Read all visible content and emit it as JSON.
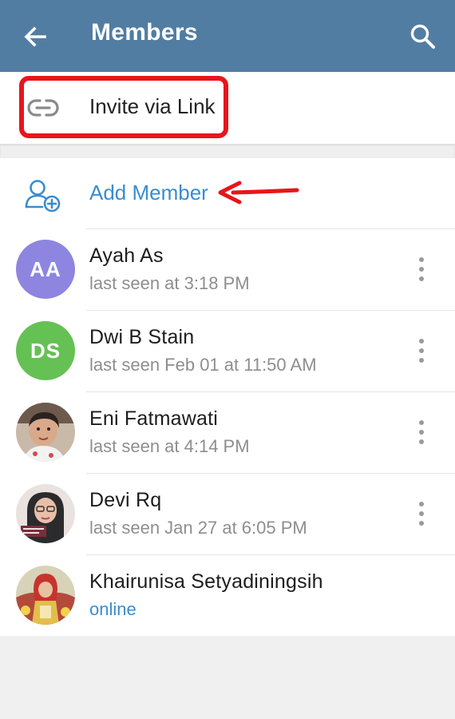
{
  "header": {
    "title": "Members",
    "back_icon": "arrow-left-icon",
    "search_icon": "search-icon",
    "background": "#527da3"
  },
  "invite": {
    "label": "Invite via Link",
    "icon": "link-icon"
  },
  "add_member": {
    "label": "Add Member",
    "icon": "add-user-icon",
    "color": "#3a8ccf"
  },
  "annotation_colors": {
    "highlight": "#e8151b"
  },
  "members": [
    {
      "name": "Ayah As",
      "status": "last seen at 3:18 PM",
      "initials": "AA",
      "avatar_color": "#8e85e0",
      "online": false,
      "menu": true
    },
    {
      "name": "Dwi B Stain",
      "status": "last seen Feb 01 at 11:50 AM",
      "initials": "DS",
      "avatar_color": "#65c154",
      "online": false,
      "menu": true
    },
    {
      "name": "Eni Fatmawati",
      "status": "last seen at 4:14 PM",
      "avatar_type": "photo",
      "online": false,
      "menu": true
    },
    {
      "name": "Devi Rq",
      "status": "last seen Jan 27 at 6:05 PM",
      "avatar_type": "photo",
      "online": false,
      "menu": true
    },
    {
      "name": "Khairunisa Setyadiningsih",
      "status": "online",
      "avatar_type": "photo",
      "online": true,
      "menu": false
    }
  ]
}
